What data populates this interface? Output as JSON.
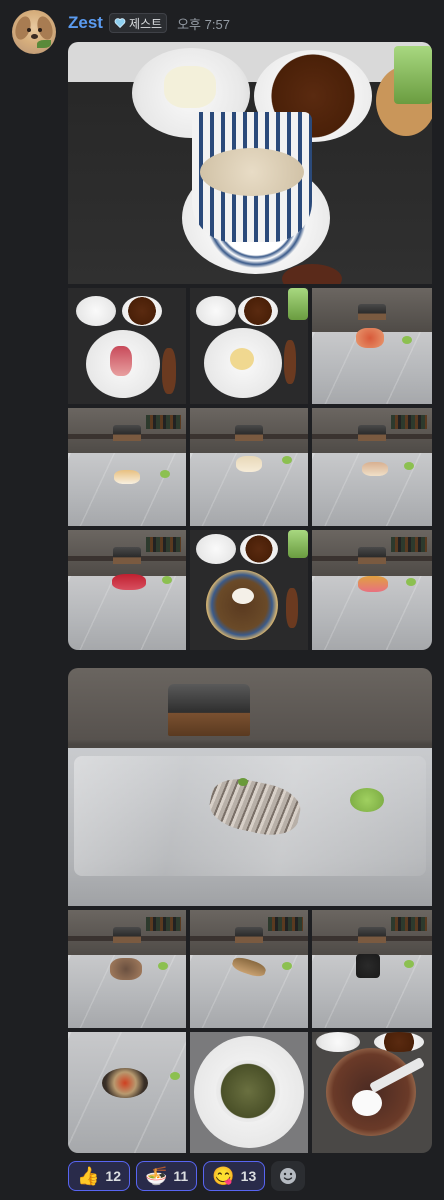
{
  "message": {
    "username": "Zest",
    "tag_label": "제스트",
    "timestamp": "오후 7:57",
    "username_color": "#5b9bf0",
    "avatar_icon": "dog-avatar-icon"
  },
  "gallery_1": {
    "hero": "chawanmushi-with-sides",
    "thumbnails": [
      "sashimi-plate",
      "appetizer-plate",
      "nigiri-1",
      "nigiri-2",
      "nigiri-3",
      "nigiri-4",
      "nigiri-tuna",
      "braised-dish",
      "nigiri-5"
    ]
  },
  "gallery_2": {
    "hero": "nigiri-mackerel",
    "thumbnails": [
      "nigiri-6",
      "nigiri-7",
      "maki-roll",
      "nigiri-8",
      "soup-bowl",
      "dessert-bowl"
    ]
  },
  "reactions": [
    {
      "emoji": "👍",
      "icon": "thumbs-up-icon",
      "count": "12"
    },
    {
      "emoji": "🍜",
      "icon": "ramen-bowl-icon",
      "count": "11"
    },
    {
      "emoji": "😋",
      "icon": "yum-face-icon",
      "count": "13"
    }
  ],
  "add_reaction_icon": "add-reaction-icon",
  "colors": {
    "background": "#1e1f22",
    "reaction_bg": "#292b4a",
    "reaction_border": "#5865f2"
  }
}
